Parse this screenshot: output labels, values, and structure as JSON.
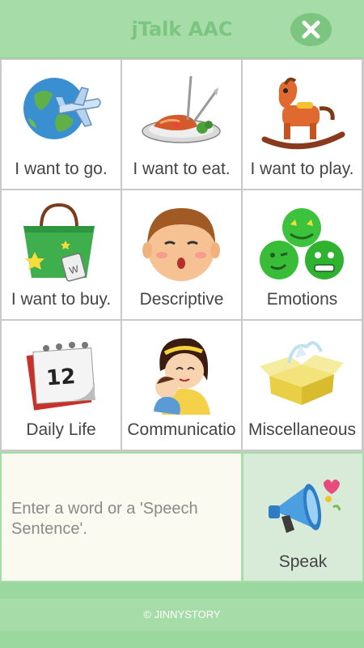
{
  "app": {
    "title": "jTalk AAC"
  },
  "categories": [
    {
      "label": "I want to go.",
      "icon": "globe-airplane-icon"
    },
    {
      "label": "I want to eat.",
      "icon": "food-plate-icon"
    },
    {
      "label": "I want to play.",
      "icon": "rocking-horse-icon"
    },
    {
      "label": "I want to buy.",
      "icon": "shopping-bag-icon"
    },
    {
      "label": "Descriptive",
      "icon": "child-face-icon"
    },
    {
      "label": "Emotions",
      "icon": "emoji-faces-icon"
    },
    {
      "label": "Daily Life",
      "icon": "calendar-icon"
    },
    {
      "label": "Communicatio",
      "icon": "mother-child-icon"
    },
    {
      "label": "Miscellaneous",
      "icon": "open-box-icon"
    }
  ],
  "input": {
    "placeholder": "Enter a word or a 'Speech Sentence'."
  },
  "speak": {
    "label": "Speak",
    "icon": "megaphone-icon"
  },
  "footer": {
    "copyright": "© JINNYSTORY"
  },
  "colors": {
    "header_bg": "#a6dca8",
    "title": "#7cc580",
    "speak_bg": "#d8ead8",
    "input_bg": "#fafaf0"
  }
}
